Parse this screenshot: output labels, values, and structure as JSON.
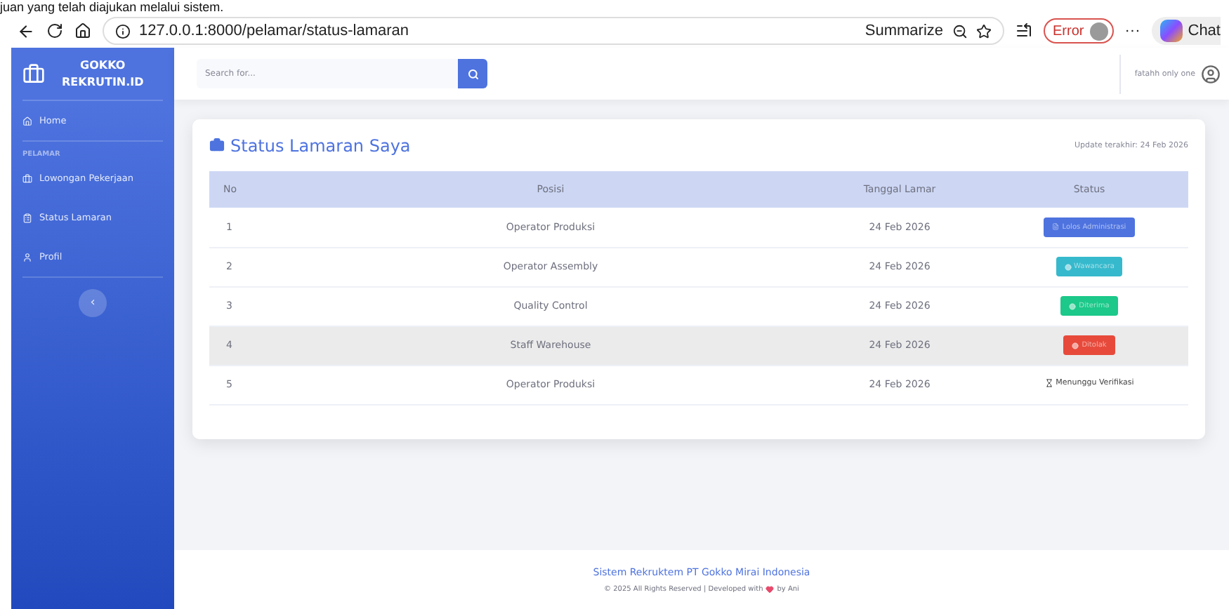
{
  "caption": "juan yang telah diajukan melalui sistem.",
  "browser": {
    "url": "127.0.0.1:8000/pelamar/status-lamaran",
    "summarize": "Summarize",
    "error": "Error",
    "more": "···",
    "chat": "Chat"
  },
  "sidebar": {
    "brand": [
      "GOKKO",
      "REKRUTIN.ID"
    ],
    "items": [
      {
        "kind": "link",
        "label": "Home"
      },
      {
        "kind": "heading",
        "label": "PELAMAR"
      },
      {
        "kind": "link",
        "label": "Lowongan Pekerjaan"
      },
      {
        "kind": "link",
        "label": "Status Lamaran"
      },
      {
        "kind": "link",
        "label": "Profil"
      }
    ],
    "toggle": "‹"
  },
  "topbar": {
    "search": {
      "placeholder": "Search for..."
    },
    "user": "fatahh only one"
  },
  "card": {
    "title": "Status Lamaran Saya",
    "updated": "Update terakhir: 24 Feb 2026",
    "table": {
      "columns": [
        "No",
        "Posisi",
        "Tanggal Lamar",
        "Status"
      ],
      "rows": [
        {
          "no": "1",
          "position": "Operator Produksi",
          "date": "24 Feb 2026",
          "status": {
            "kind": "badge",
            "label": "Lolos Administrasi",
            "color": "#4e73df"
          },
          "highlighted": false
        },
        {
          "no": "2",
          "position": "Operator Assembly",
          "date": "24 Feb 2026",
          "status": {
            "kind": "badge",
            "label": "Wawancara",
            "color": "#36b9cc"
          },
          "highlighted": false
        },
        {
          "no": "3",
          "position": "Quality Control",
          "date": "24 Feb 2026",
          "status": {
            "kind": "badge",
            "label": "Diterima",
            "color": "#1cc88a"
          },
          "highlighted": false
        },
        {
          "no": "4",
          "position": "Staff Warehouse",
          "date": "24 Feb 2026",
          "status": {
            "kind": "badge",
            "label": "Ditolak",
            "color": "#e74a3b"
          },
          "highlighted": true
        },
        {
          "no": "5",
          "position": "Operator Produksi",
          "date": "24 Feb 2026",
          "status": {
            "kind": "pending",
            "label": "Menunggu Verifikasi"
          },
          "highlighted": false
        }
      ]
    }
  },
  "footer": {
    "title": "Sistem Rekruktem PT Gokko Mirai Indonesia",
    "copyright": [
      "© 2025 All Rights Reserved | Developed with",
      "by Ani"
    ]
  }
}
